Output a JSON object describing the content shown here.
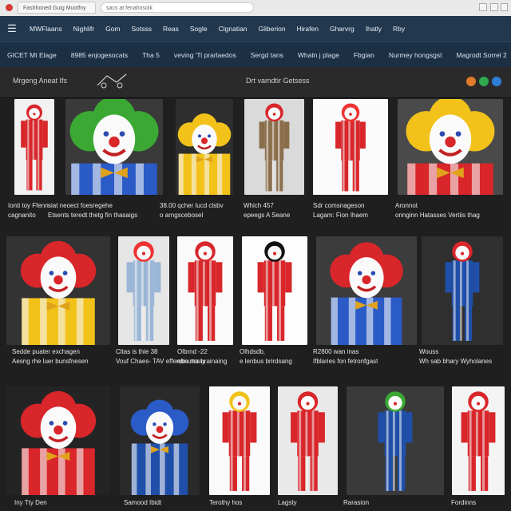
{
  "browser": {
    "tab_title": "Fashhoned Guig Muotfny",
    "address": "sacs at fenahnsolk"
  },
  "topnav": {
    "items": [
      "MWFlaans",
      "Nighlifr",
      "Gom",
      "Sotsss",
      "Reas",
      "Sogle",
      "Clgnatian",
      "Gliberion",
      "Hirafen",
      "Gharvrg",
      "Ihatly",
      "Rby"
    ]
  },
  "subnav": {
    "items": [
      "GICET Mt Elage",
      "8985 enjogesocats",
      "Tha 5",
      "veving 'Ti prarlaedos",
      "Sergd tans",
      "Whatn j plage",
      "Fbgian",
      "Nurmey hongsgst",
      "Magrodt Sorrel 2"
    ]
  },
  "toolbar": {
    "left_label": "Mrgeng Aneat Ifs",
    "center_label": "Drt vamdtir Getsess"
  },
  "palette": {
    "nav_bg": "#22384f",
    "subnav_bg": "#1b2f45",
    "page_bg": "#1f1f1f"
  },
  "cards": [
    {
      "lines": [
        "Ionti toy Ffenn",
        "cagnanito"
      ]
    },
    {
      "lines": [
        "siat neoect foesregehe",
        "Etsents teredt thetg fin thasaigs"
      ]
    },
    {
      "lines": [
        "38.00 qcher lucd clsbv",
        "o arngscebosel"
      ]
    },
    {
      "lines": [
        "Which 457",
        "epeegs A Seane"
      ]
    },
    {
      "lines": [
        "Sdr comsnageson",
        "Lagam: Fion Ihaem"
      ]
    },
    {
      "lines": [
        "Aronnot",
        "onnginn Hatasses Vertiis thag"
      ]
    },
    {
      "lines": [
        "Sedde puater exchagen",
        "Aesng rhe luer bunsfnesen"
      ]
    },
    {
      "lines": [
        "Cltas is thie 38",
        "Vouf Chaes- TAV efferstis maay"
      ]
    },
    {
      "lines": [
        "Olbrnd -22",
        "eboutor brainaing"
      ]
    },
    {
      "lines": [
        "Olhdsdb,",
        "e lenbus brirdsang"
      ]
    },
    {
      "lines": [
        "R2800 wan inas",
        "Ifblaries fon fetronfgast"
      ]
    },
    {
      "lines": [
        "Wouss",
        "Wh sab bhary Wyholanes"
      ]
    },
    {
      "lines": [
        "Iny Tty Den"
      ]
    },
    {
      "lines": [
        "Samood Ibidt"
      ]
    },
    {
      "lines": [
        "Terothy hos"
      ]
    },
    {
      "lines": [
        "Lagsty"
      ]
    },
    {
      "lines": [
        "Rarasion"
      ]
    },
    {
      "lines": [
        "Fordinns"
      ]
    }
  ]
}
